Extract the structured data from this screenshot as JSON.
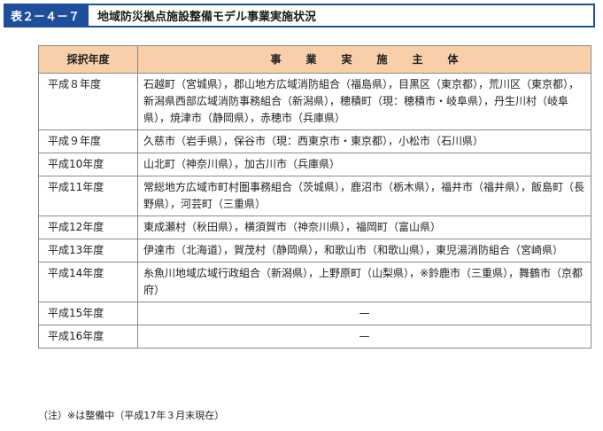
{
  "title": {
    "label": "表２－４－７",
    "text": "地域防災拠点施設整備モデル事業実施状況"
  },
  "table": {
    "headers": [
      "採択年度",
      "事業実施主体"
    ],
    "rows": [
      {
        "year": "平成８年度",
        "bodies": "石越町（宮城県），郡山地方広域消防組合（福島県），目黒区（東京都），荒川区（東京都），新潟県西部広域消防事務組合（新潟県），穂積町（現：穂積市・岐阜県），丹生川村（岐阜県），焼津市（静岡県），赤穂市（兵庫県）"
      },
      {
        "year": "平成９年度",
        "bodies": "久慈市（岩手県），保谷市（現：西東京市・東京都），小松市（石川県）"
      },
      {
        "year": "平成10年度",
        "bodies": "山北町（神奈川県），加古川市（兵庫県）"
      },
      {
        "year": "平成11年度",
        "bodies": "常総地方広域市町村圏事務組合（茨城県），鹿沼市（栃木県），福井市（福井県），飯島町（長野県），河芸町（三重県）"
      },
      {
        "year": "平成12年度",
        "bodies": "東成瀬村（秋田県），横須賀市（神奈川県），福岡町（富山県）"
      },
      {
        "year": "平成13年度",
        "bodies": "伊達市（北海道），賀茂村（静岡県），和歌山市（和歌山県），東児湯消防組合（宮崎県）"
      },
      {
        "year": "平成14年度",
        "bodies": "糸魚川地域広域行政組合（新潟県），上野原町（山梨県），※鈴鹿市（三重県），舞鶴市（京都府）"
      },
      {
        "year": "平成15年度",
        "bodies": "—"
      },
      {
        "year": "平成16年度",
        "bodies": "—"
      }
    ]
  },
  "note": "（注）※は整備中（平成17年３月末現在）",
  "colors": {
    "title_bg": "#1f4e9c",
    "header_bg": "#f8cfa8",
    "border": "#8a8a8a"
  }
}
